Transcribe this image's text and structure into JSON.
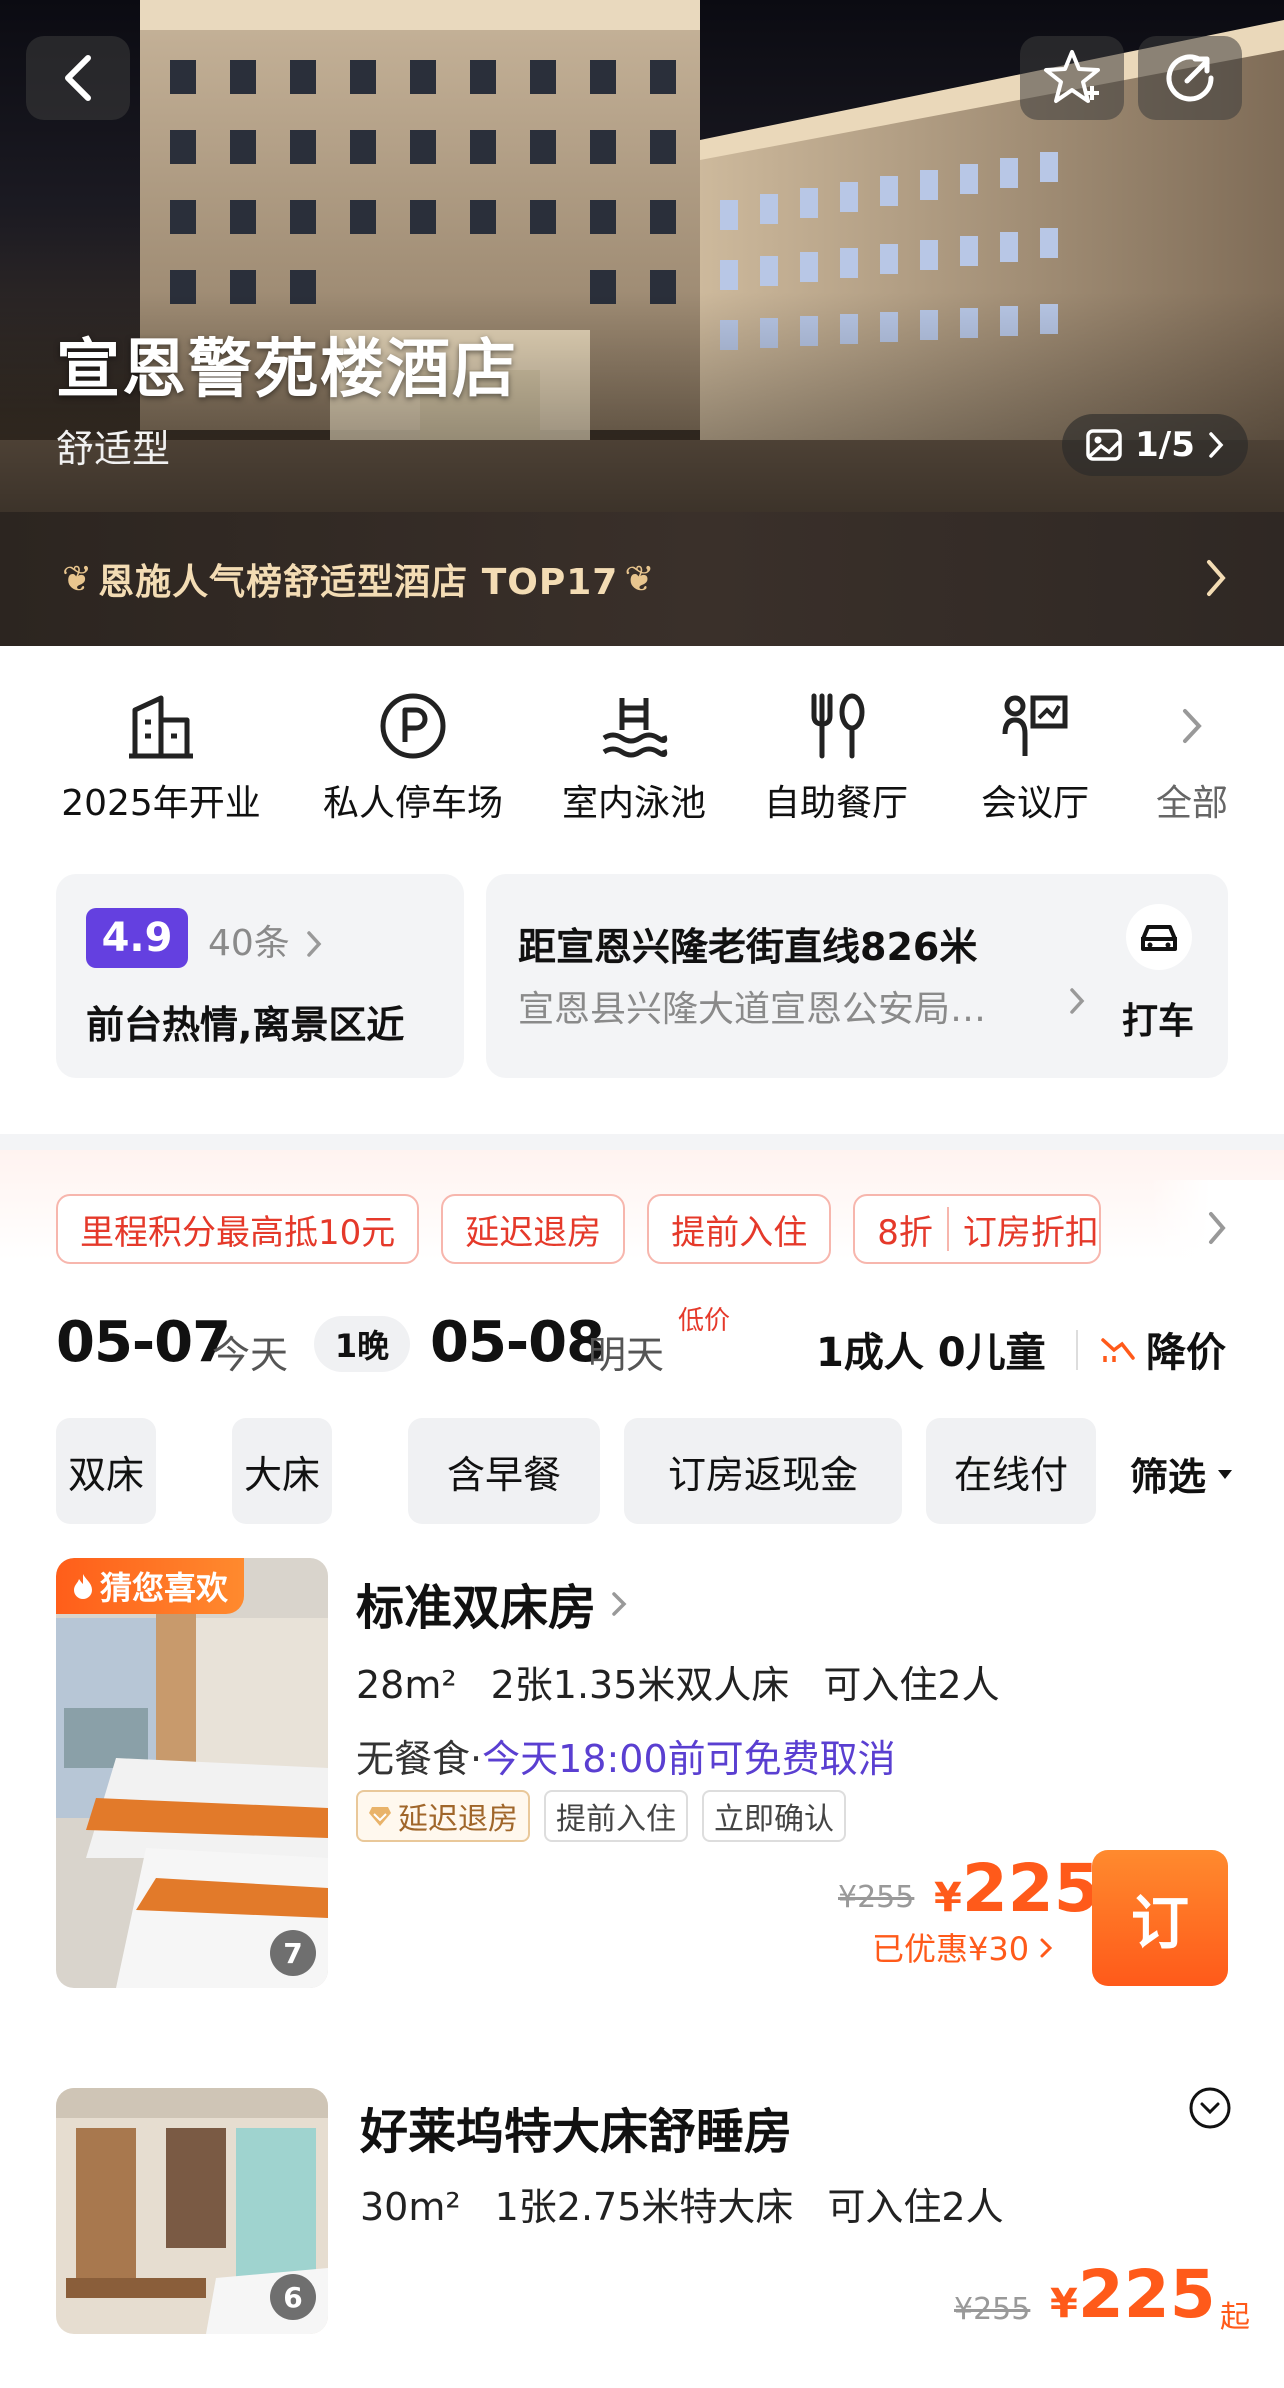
{
  "hero": {
    "hotel_name": "宣恩警苑楼酒店",
    "hotel_type": "舒适型",
    "photo_counter": "1/5"
  },
  "rank_banner": {
    "text": "恩施人气榜舒适型酒店 TOP17"
  },
  "facilities": [
    {
      "label": "2025年开业",
      "icon": "building-icon"
    },
    {
      "label": "私人停车场",
      "icon": "parking-icon"
    },
    {
      "label": "室内泳池",
      "icon": "pool-icon"
    },
    {
      "label": "自助餐厅",
      "icon": "restaurant-icon"
    },
    {
      "label": "会议厅",
      "icon": "meeting-icon"
    },
    {
      "label": "全部",
      "icon": "chevron-right-icon"
    }
  ],
  "review": {
    "score": "4.9",
    "count": "40条",
    "summary": "前台热情,离景区近"
  },
  "location": {
    "distance": "距宣恩兴隆老街直线826米",
    "address": "宣恩县兴隆大道宣恩公安局…",
    "taxi_label": "打车"
  },
  "promo_tags": [
    "里程积分最高抵10元",
    "延迟退房",
    "提前入住",
    "8折",
    "订房折扣"
  ],
  "dates": {
    "checkin": "05-07",
    "checkin_day": "今天",
    "nights": "1晚",
    "checkout": "05-08",
    "checkout_day": "明天",
    "low_price": "低价",
    "guests": "1成人 0儿童",
    "price_drop": "降价"
  },
  "filters": [
    "双床",
    "大床",
    "含早餐",
    "订房返现金",
    "在线付"
  ],
  "filter_button": "筛选",
  "rooms": [
    {
      "badge": "猜您喜欢",
      "name": "标准双床房",
      "area": "28m²",
      "bed": "2张1.35米双人床",
      "capacity": "可入住2人",
      "meal": "无餐食",
      "cancel": "今天18:00前可免费取消",
      "tags": [
        "延迟退房",
        "提前入住",
        "立即确认"
      ],
      "photo_count": "7",
      "old_price": "¥255",
      "price": "225",
      "currency": "¥",
      "saved": "已优惠¥30",
      "book_label": "订"
    },
    {
      "name": "好莱坞特大床舒睡房",
      "area": "30m²",
      "bed": "1张2.75米特大床",
      "capacity": "可入住2人",
      "photo_count": "6",
      "old_price": "¥255",
      "price": "225",
      "currency": "¥",
      "price_suffix": "起"
    }
  ],
  "colors": {
    "accent": "#ff5a1a",
    "score": "#6440e0",
    "promo": "#e5392a",
    "cancel": "#5a3fd1"
  }
}
